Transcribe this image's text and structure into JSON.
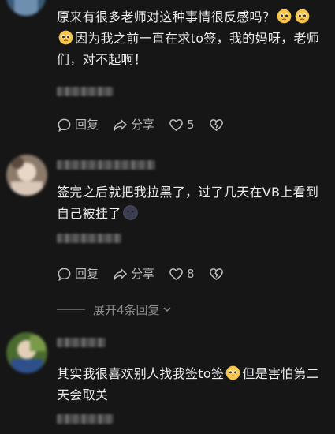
{
  "comments": [
    {
      "text_part1": "原来有很多老师对这种事情很反感吗？",
      "text_part2": "因为我之前一直在求to签，我的妈呀，老师们，对不起啊！",
      "reply_label": "回复",
      "share_label": "分享",
      "like_count": "5"
    },
    {
      "text": "签完之后就把我拉黑了，过了几天在VB上看到自己被挂了",
      "reply_label": "回复",
      "share_label": "分享",
      "like_count": "8"
    },
    {
      "text_part1": "其实我很喜欢别人找我签to签",
      "text_part2": "但是害怕第二天会取关"
    }
  ],
  "expand_replies_label": "展开4条回复",
  "icons": {
    "reply": "comment-bubble-icon",
    "share": "share-arrow-icon",
    "like": "heart-icon",
    "dislike": "broken-heart-icon",
    "expand": "chevron-down-icon",
    "emoji_plead": "pleading-face-emoji",
    "emoji_dark": "dark-moon-face-emoji"
  },
  "colors": {
    "background": "#161616",
    "text": "#eeeeee",
    "secondary_text": "#bdbdbd",
    "emoji_yellow": "#f6c54a"
  }
}
